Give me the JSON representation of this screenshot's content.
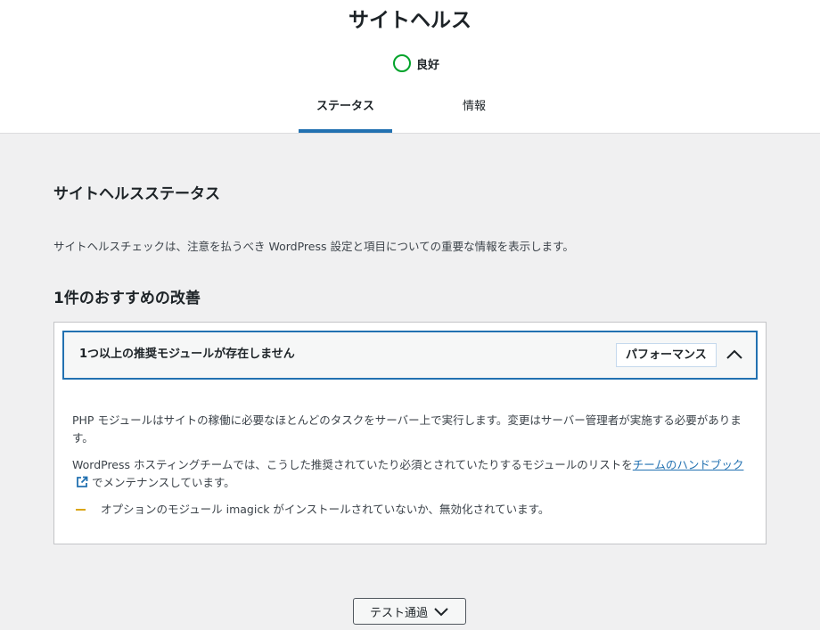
{
  "header": {
    "title": "サイトヘルス",
    "status_label": "良好",
    "status_color": "#00a32a"
  },
  "tabs": [
    {
      "label": "ステータス",
      "active": true
    },
    {
      "label": "情報",
      "active": false
    }
  ],
  "section": {
    "title": "サイトヘルスステータス",
    "description": "サイトヘルスチェックは、注意を払うべき WordPress 設定と項目についての重要な情報を表示します。",
    "issues_heading": "1件のおすすめの改善"
  },
  "issue": {
    "title": "1つ以上の推奨モジュールが存在しません",
    "badge": "パフォーマンス",
    "paragraph1": "PHP モジュールはサイトの稼働に必要なほとんどのタスクをサーバー上で実行します。変更はサーバー管理者が実施する必要があります。",
    "paragraph2_before": "WordPress ホスティングチームでは、こうした推奨されていたり必須とされていたりするモジュールのリストを",
    "paragraph2_link": "チームのハンドブック",
    "paragraph2_after": "でメンテナンスしています。",
    "warning": "オプションのモジュール imagick がインストールされていないか、無効化されています。"
  },
  "footer": {
    "toggle_label": "テスト通過"
  },
  "colors": {
    "accent": "#2271b1",
    "warning": "#dba617",
    "good": "#00a32a"
  }
}
